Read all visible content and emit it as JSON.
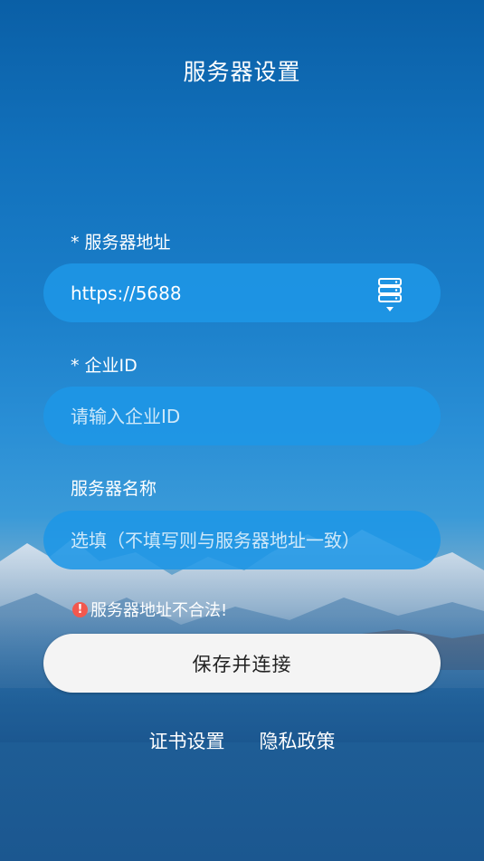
{
  "page": {
    "title": "服务器设置"
  },
  "form": {
    "server_address": {
      "label": "* 服务器地址",
      "value": "https://5688",
      "placeholder": ""
    },
    "enterprise_id": {
      "label": "* 企业ID",
      "value": "",
      "placeholder": "请输入企业ID"
    },
    "server_name": {
      "label": "服务器名称",
      "value": "",
      "placeholder": "选填（不填写则与服务器地址一致）"
    }
  },
  "error": {
    "icon": "!",
    "message": "服务器地址不合法!"
  },
  "actions": {
    "save_label": "保存并连接"
  },
  "footer": {
    "certificate_settings": "证书设置",
    "privacy_policy": "隐私政策"
  },
  "icons": {
    "server_list": "server-stack-icon",
    "dropdown": "caret-down-icon",
    "error": "exclamation-circle-icon"
  },
  "colors": {
    "field_bg": "#1e96e6",
    "error_icon": "#f2584e",
    "button_bg": "#f4f4f4"
  }
}
